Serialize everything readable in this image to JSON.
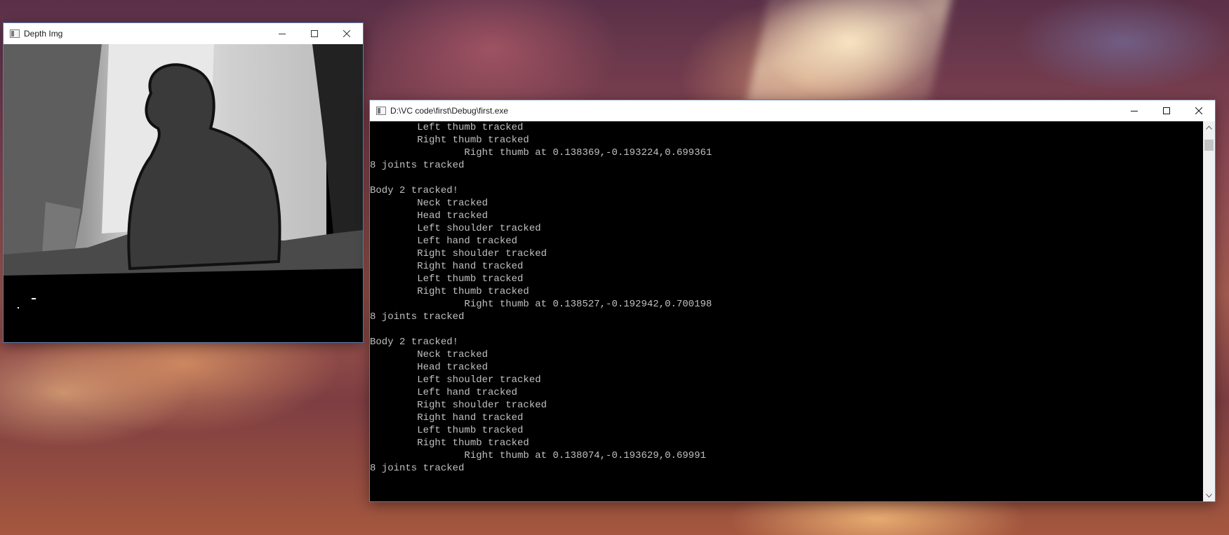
{
  "desktop": {
    "wallpaper": "anime-sunset-clouds"
  },
  "depth_window": {
    "title": "Depth Img",
    "icon": "window-app-icon",
    "controls": [
      "minimize-icon",
      "maximize-icon",
      "close-icon"
    ]
  },
  "console_window": {
    "title": "D:\\VC code\\first\\Debug\\first.exe",
    "icon": "console-app-icon",
    "controls": [
      "minimize-icon",
      "maximize-icon",
      "close-icon"
    ],
    "lines": [
      "        Left thumb tracked",
      "        Right thumb tracked",
      "                Right thumb at 0.138369,-0.193224,0.699361",
      "8 joints tracked",
      "",
      "Body 2 tracked!",
      "        Neck tracked",
      "        Head tracked",
      "        Left shoulder tracked",
      "        Left hand tracked",
      "        Right shoulder tracked",
      "        Right hand tracked",
      "        Left thumb tracked",
      "        Right thumb tracked",
      "                Right thumb at 0.138527,-0.192942,0.700198",
      "8 joints tracked",
      "",
      "Body 2 tracked!",
      "        Neck tracked",
      "        Head tracked",
      "        Left shoulder tracked",
      "        Left hand tracked",
      "        Right shoulder tracked",
      "        Right hand tracked",
      "        Left thumb tracked",
      "        Right thumb tracked",
      "                Right thumb at 0.138074,-0.193629,0.69991",
      "8 joints tracked"
    ]
  },
  "colors": {
    "console_bg": "#000000",
    "console_text": "#c0c0c0",
    "window_border": "#5b7fb3"
  }
}
